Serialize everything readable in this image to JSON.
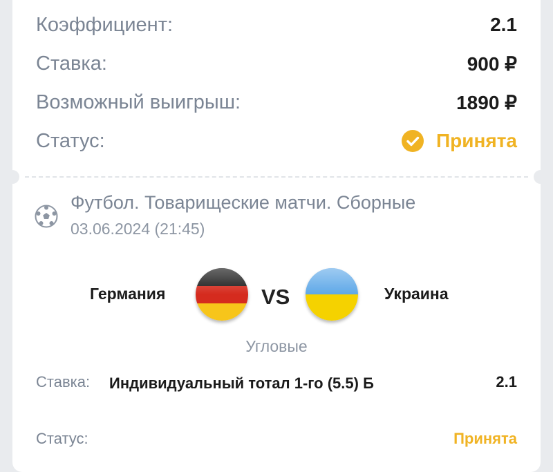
{
  "summary": {
    "coefficient_label": "Коэффициент:",
    "coefficient_value": "2.1",
    "stake_label": "Ставка:",
    "stake_value": "900 ₽",
    "payout_label": "Возможный выигрыш:",
    "payout_value": "1890 ₽",
    "status_label": "Статус:",
    "status_value": "Принята",
    "status_icon": "check-circle-icon",
    "status_color": "#f0b323"
  },
  "event": {
    "sport_icon": "soccer-ball-icon",
    "league": "Футбол. Товарищеские матчи. Сборные",
    "datetime": "03.06.2024 (21:45)",
    "home_team": "Германия",
    "away_team": "Украина",
    "vs_label": "VS",
    "market": "Угловые"
  },
  "selection": {
    "bet_label": "Ставка:",
    "bet_description": "Индивидуальный тотал 1-го (5.5) Б",
    "odds": "2.1",
    "status_label": "Статус:",
    "status_value": "Принята"
  }
}
